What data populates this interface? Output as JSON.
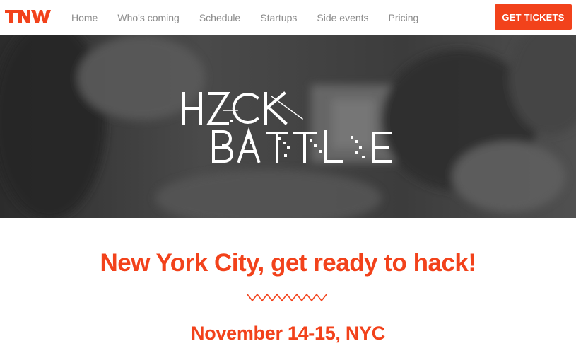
{
  "brand": {
    "logo_text": "TNW",
    "accent_color": "#f2421b"
  },
  "nav": {
    "items": [
      {
        "label": "Home"
      },
      {
        "label": "Who's coming"
      },
      {
        "label": "Schedule"
      },
      {
        "label": "Startups"
      },
      {
        "label": "Side events"
      },
      {
        "label": "Pricing"
      }
    ],
    "cta_label": "GET TICKETS"
  },
  "hero": {
    "logo_line1": "HACK",
    "logo_line2": "BATTLE"
  },
  "main": {
    "headline": "New York City, get ready to hack!",
    "dateline": "November 14-15, NYC"
  }
}
